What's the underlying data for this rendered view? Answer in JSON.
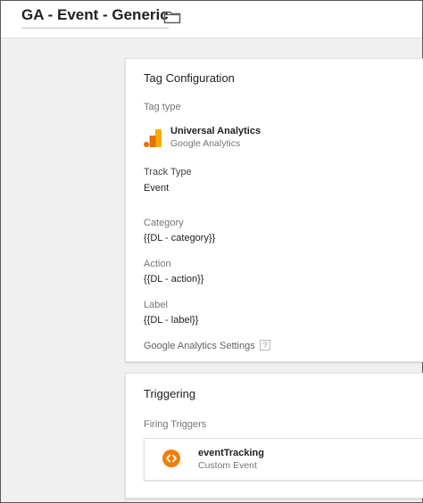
{
  "header": {
    "title": "GA - Event - Generic",
    "folder_icon": "folder-icon"
  },
  "tag_configuration": {
    "title": "Tag Configuration",
    "tag_type_label": "Tag type",
    "tag_type_name": "Universal Analytics",
    "tag_type_vendor": "Google Analytics",
    "tag_type_icon": "google-analytics-icon",
    "track_type_label": "Track Type",
    "track_type_value": "Event",
    "category_label": "Category",
    "category_value": "{{DL - category}}",
    "action_label": "Action",
    "action_value": "{{DL - action}}",
    "label_label": "Label",
    "label_value": "{{DL - label}}",
    "settings_label": "Google Analytics Settings",
    "help_glyph": "?"
  },
  "triggering": {
    "title": "Triggering",
    "firing_triggers_label": "Firing Triggers",
    "trigger": {
      "name": "eventTracking",
      "type": "Custom Event",
      "icon": "custom-event-icon"
    }
  },
  "colors": {
    "ga_orange": "#f9ab00",
    "ga_orange_dark": "#e37400",
    "trigger_orange": "#f57c00"
  }
}
